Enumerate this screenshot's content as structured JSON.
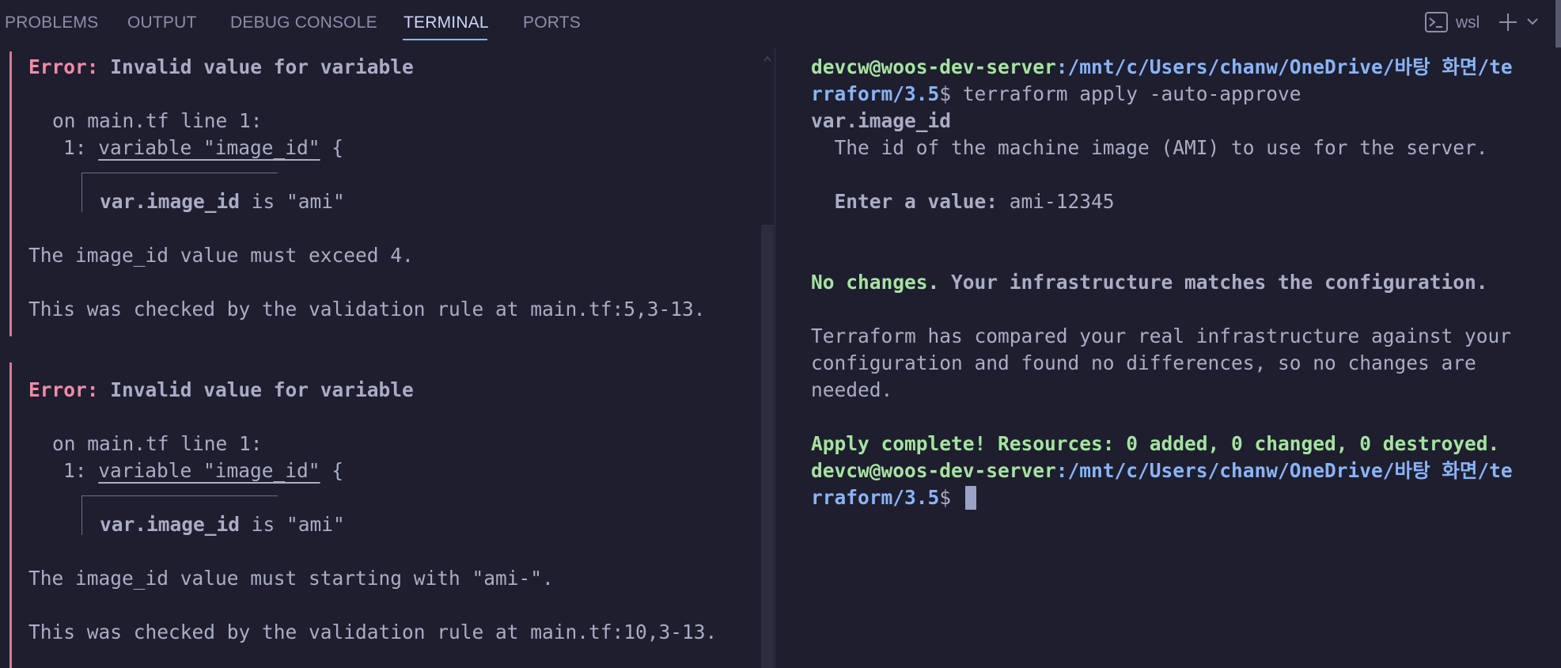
{
  "tabs": [
    {
      "label": "PROBLEMS"
    },
    {
      "label": "OUTPUT"
    },
    {
      "label": "DEBUG CONSOLE"
    },
    {
      "label": "TERMINAL",
      "active": true
    },
    {
      "label": "PORTS"
    }
  ],
  "toolbar": {
    "shell_label": "wsl",
    "icons": [
      "terminal-icon",
      "plus-icon",
      "chevron-down-icon"
    ]
  },
  "left_terminal": {
    "errors": [
      {
        "prefix": "Error:",
        "title": "Invalid value for variable",
        "location": "on main.tf line 1:",
        "line_num": "1:",
        "line_code": "variable \"image_id\"",
        "line_brace": " {",
        "var_name": "var.image_id",
        "var_value": " is \"ami\"",
        "message": "The image_id value must exceed 4.",
        "check": "This was checked by the validation rule at main.tf:5,3-13."
      },
      {
        "prefix": "Error:",
        "title": "Invalid value for variable",
        "location": "on main.tf line 1:",
        "line_num": "1:",
        "line_code": "variable \"image_id\"",
        "line_brace": " {",
        "var_name": "var.image_id",
        "var_value": " is \"ami\"",
        "message": "The image_id value must starting with \"ami-\".",
        "check": "This was checked by the validation rule at main.tf:10,3-13."
      }
    ]
  },
  "right_terminal": {
    "prompt_user": "devcw@woos-dev-server",
    "prompt_path_line1": ":/mnt/c/Users/chanw/OneDrive/바탕 화면/te",
    "prompt_path_line2": "rraform/3.5",
    "prompt_symbol": "$",
    "command": " terraform apply -auto-approve",
    "var_label": "var.image_id",
    "var_description": "  The id of the machine image (AMI) to use for the server.",
    "enter_label": "  Enter a value:",
    "enter_value": " ami-12345",
    "no_changes": "No changes.",
    "no_changes_rest": " Your infrastructure matches the configuration.",
    "compare_lines": [
      "Terraform has compared your real infrastructure against your",
      "configuration and found no differences, so no changes are",
      "needed."
    ],
    "apply_complete": "Apply complete! Resources: 0 added, 0 changed, 0 destroyed."
  },
  "colors": {
    "background": "#1e1e2e",
    "error_red": "#f38ba8",
    "prompt_green": "#a6e3a1",
    "path_blue": "#89b4fa",
    "text": "#a9adc5"
  }
}
